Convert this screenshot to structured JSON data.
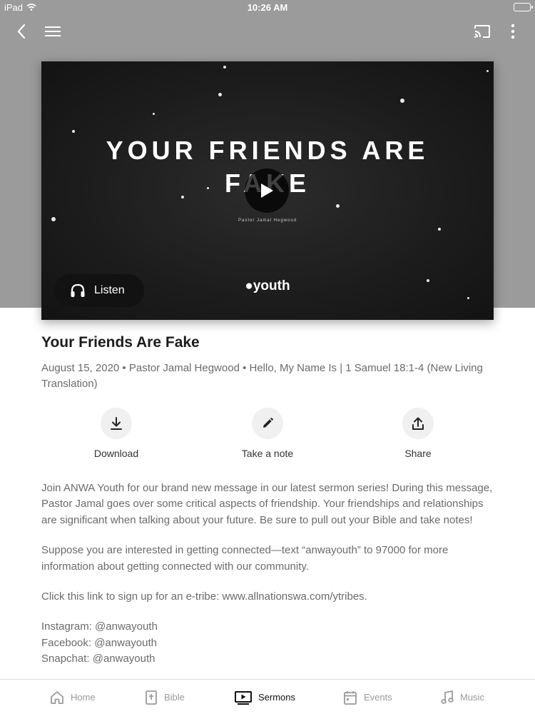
{
  "status_bar": {
    "device": "iPad",
    "time": "10:26 AM"
  },
  "artwork": {
    "title_line1": "YOUR FRIENDS ARE",
    "title_line2": "FAKE",
    "speaker": "Pastor Jamal Hegwood",
    "logo": "●youth",
    "listen_label": "Listen"
  },
  "sermon": {
    "title": "Your Friends Are Fake",
    "meta": "August 15, 2020 • Pastor Jamal Hegwood • Hello, My Name Is | 1 Samuel 18:1-4 (New Living Translation)"
  },
  "actions": {
    "download": "Download",
    "note": "Take a note",
    "share": "Share"
  },
  "description": {
    "p1": "Join ANWA Youth for our brand new message in our latest sermon series! During this message, Pastor Jamal goes over some critical aspects of friendship. Your friendships and relationships are significant when talking about your future. Be sure to pull out your Bible and take notes!",
    "p2": "Suppose you are interested in getting connected—text “anwayouth” to 97000 for more information about getting connected with our community.",
    "p3": "Click this link to sign up for an e-tribe: www.allnationswa.com/ytribes.",
    "instagram": "Instagram: @anwayouth",
    "facebook": "Facebook: @anwayouth",
    "snapchat": "Snapchat: @anwayouth"
  },
  "tabs": {
    "home": "Home",
    "bible": "Bible",
    "sermons": "Sermons",
    "events": "Events",
    "music": "Music"
  },
  "colors": {
    "header_gray": "#9b9b9b",
    "text_dark": "#1c1c1c",
    "text_muted": "#6b6b6b",
    "tab_inactive": "#9a9a9a"
  }
}
